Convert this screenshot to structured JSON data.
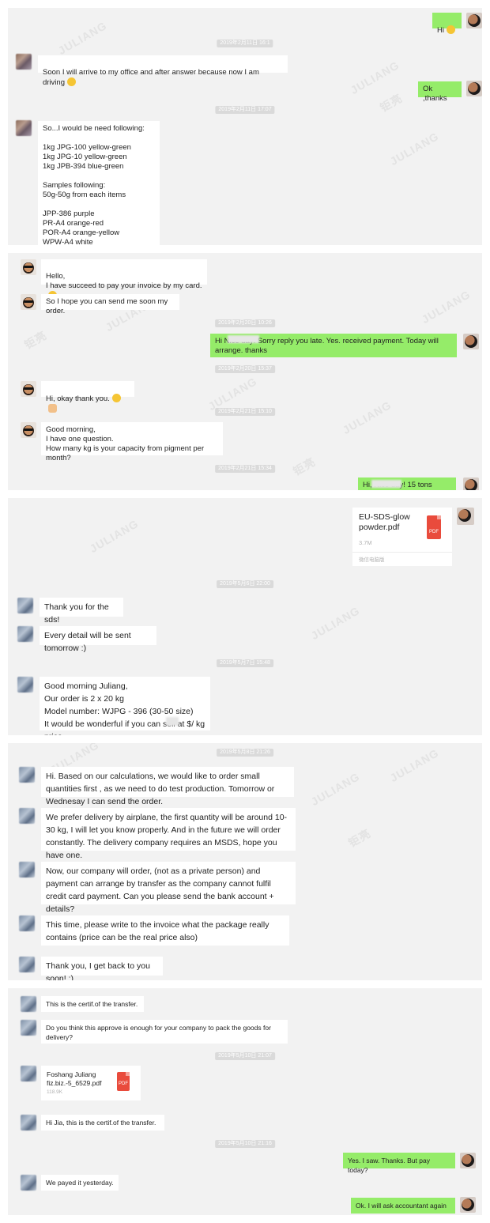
{
  "panel1": {
    "m1": {
      "text": "Hi"
    },
    "ts1": "2019年2月11日 16:1",
    "m2": {
      "text": "Soon I will arrive to my office and after answer because now I am driving"
    },
    "m3": {
      "text": "Ok ,thanks"
    },
    "ts2": "2019年2月11日 17:07",
    "m4": {
      "text": "So...I would be need following:\n\n1kg JPG-100 yellow-green\n1kg JPG-10 yellow-green\n1kg JPB-394 blue-green\n\nSamples following:\n50g-50g from each items\n\nJPP-386 purple\nPR-A4 orange-red\nPOR-A4 orange-yellow\nWPW-A4 white"
    }
  },
  "panel2": {
    "m1": {
      "text": "Hello,\nI have succeed to pay your invoice by my card."
    },
    "m2": {
      "text": "So I hope you can send me soon my order."
    },
    "ts1": "2019年2月20日 10:26",
    "m3": {
      "text": "Hi            Nice day! Sorry reply you late. Yes. received payment. Today will arrange. thanks"
    },
    "ts2": "2019年2月20日 15:37",
    "m4": {
      "text": "Hi, okay thank you."
    },
    "ts3": "2019年2月21日 15:10",
    "m5": {
      "text": "Good morning,\nI have one question.\nHow many kg is your capacity from pigment per month?"
    },
    "ts4": "2019年2月21日 15:34",
    "m6": {
      "text": "Hi,            Nice day! 15 tons"
    }
  },
  "panel3": {
    "file": {
      "name": "EU-SDS-glow\npowder.pdf",
      "size": "3.7M",
      "source": "微信电脑版",
      "icon_label": "PDF"
    },
    "ts1": "2019年5月6日 22:00",
    "m1": {
      "text": "Thank you for the sds!"
    },
    "m2": {
      "text": "Every detail will be sent tomorrow :)"
    },
    "ts2": "2019年5月7日 15:48",
    "m3": {
      "text": "Good morning Juliang,\nOur order is 2 x 20 kg\nModel number: WJPG - 396 (30-50 size)\nIt would be wonderful if you can sell at      $/ kg price"
    }
  },
  "panel4": {
    "ts1": "2019年5月8日 21:26",
    "m1": {
      "text": "Hi. Based on our calculations, we would like to order small quantities first , as we need to do test production. Tomorrow or Wednesay I can send the order."
    },
    "m2": {
      "text": "We prefer delivery by airplane, the first quantity will be around 10-30 kg, I will let you know properly. And in the future we will order constantly. The delivery company requires an MSDS, hope you have one."
    },
    "m3": {
      "text": "Now, our company will order, (not as a private person) and payment can arrange by transfer as the company cannot fulfil credit card payment. Can you please send the bank account + details?"
    },
    "m4": {
      "text": "This time, please write to the invoice what the package really contains (price can be the real price also)"
    },
    "m5": {
      "text": "Thank you, I get back to you soon! :)"
    }
  },
  "panel5": {
    "m1": {
      "text": "This is the certif.of the transfer."
    },
    "m2": {
      "text": "Do you think this approve is enough for your company to pack the goods for delivery?"
    },
    "ts1": "2019年5月10日 21:07",
    "file": {
      "name": "Foshang Juliang\nfiz.biz.-5_6529.pdf",
      "size": "118.9K",
      "icon_label": "PDF"
    },
    "m3": {
      "text": "Hi Jia, this is the certif.of the transfer."
    },
    "ts2": "2019年5月10日 21:16",
    "m4": {
      "text": "Yes. I saw. Thanks. But pay today?"
    },
    "m5": {
      "text": "We payed it yesterday."
    },
    "m6": {
      "text": "Ok. I will ask accountant again"
    }
  },
  "watermark": {
    "latin": "JULIANG",
    "cn": "钜亮"
  },
  "colors": {
    "panel_bg": "#f2f2f2",
    "bubble_self": "#95ec69",
    "bubble_other": "#ffffff",
    "pdf_red": "#e94b3c"
  }
}
